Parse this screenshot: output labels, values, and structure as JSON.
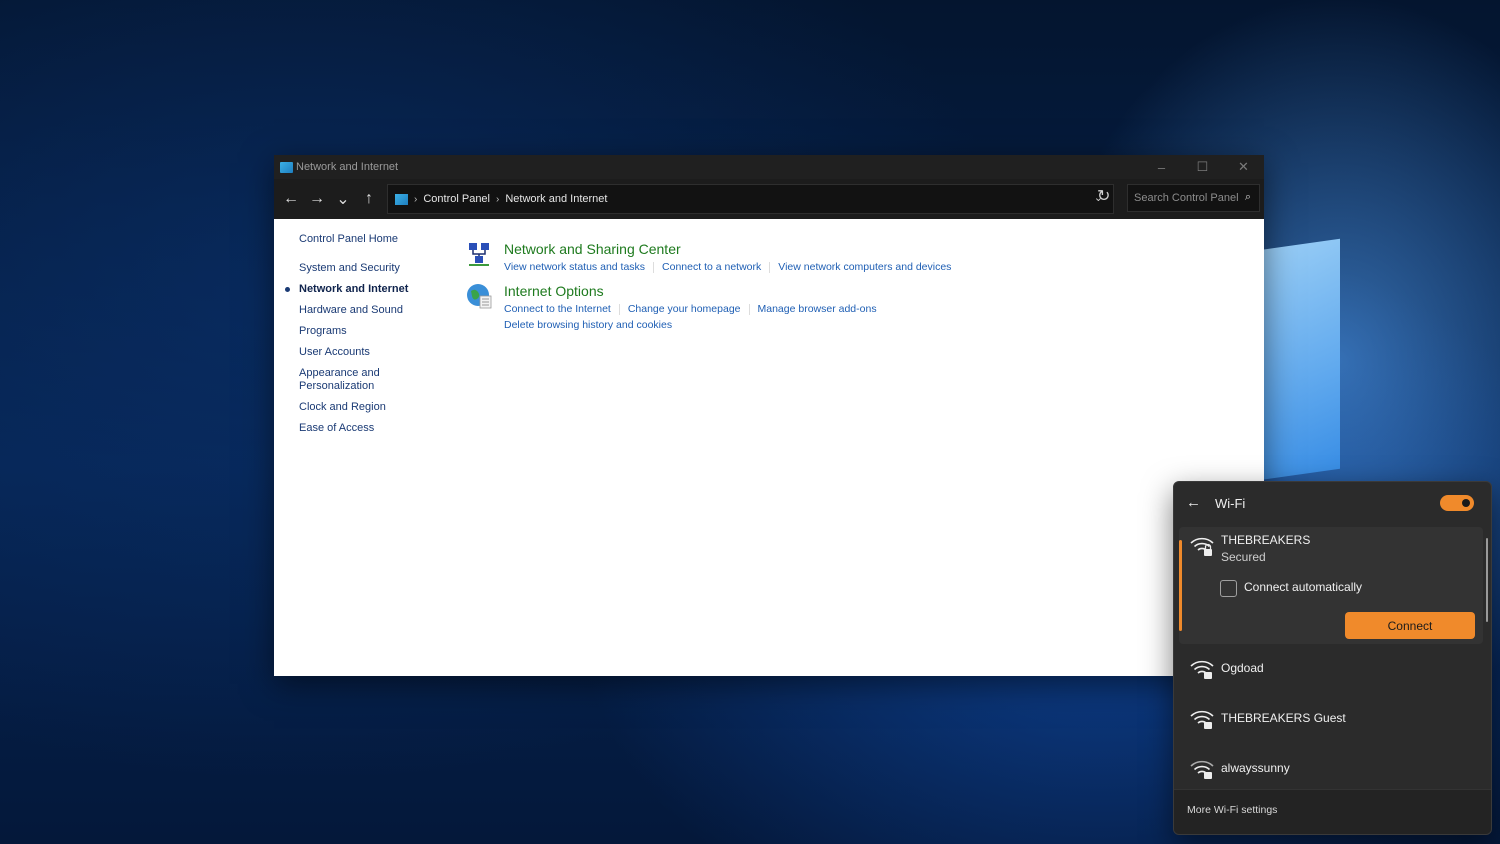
{
  "window": {
    "title": "Network and Internet",
    "controls": {
      "minimize": "–",
      "maximize": "☐",
      "close": "✕"
    }
  },
  "toolbar": {
    "back": "←",
    "forward": "→",
    "recent": "⌄",
    "up": "↑",
    "breadcrumb": [
      "Control Panel",
      "Network and Internet"
    ],
    "separator": "›",
    "dropdown": "⌄",
    "refresh": "↻",
    "search_placeholder": "Search Control Panel",
    "search_icon": "⌕"
  },
  "sidebar": {
    "home": "Control Panel Home",
    "items": [
      {
        "label": "System and Security"
      },
      {
        "label": "Network and Internet",
        "active": true
      },
      {
        "label": "Hardware and Sound"
      },
      {
        "label": "Programs"
      },
      {
        "label": "User Accounts"
      },
      {
        "label": "Appearance and Personalization"
      },
      {
        "label": "Clock and Region"
      },
      {
        "label": "Ease of Access"
      }
    ]
  },
  "categories": [
    {
      "title": "Network and Sharing Center",
      "icon": "network-sharing-icon",
      "links": [
        "View network status and tasks",
        "Connect to a network",
        "View network computers and devices"
      ]
    },
    {
      "title": "Internet Options",
      "icon": "internet-options-icon",
      "links": [
        "Connect to the Internet",
        "Change your homepage",
        "Manage browser add-ons"
      ],
      "links_row2": [
        "Delete browsing history and cookies"
      ]
    }
  ],
  "wifi": {
    "back": "←",
    "title": "Wi-Fi",
    "toggle_on": true,
    "selected": {
      "name": "THEBREAKERS",
      "status": "Secured",
      "auto_label": "Connect automatically",
      "connect_label": "Connect"
    },
    "networks": [
      {
        "name": "Ogdoad"
      },
      {
        "name": "THEBREAKERS Guest"
      },
      {
        "name": "alwayssunny"
      }
    ],
    "more": "More Wi-Fi settings",
    "accent": "#f08a2b"
  }
}
